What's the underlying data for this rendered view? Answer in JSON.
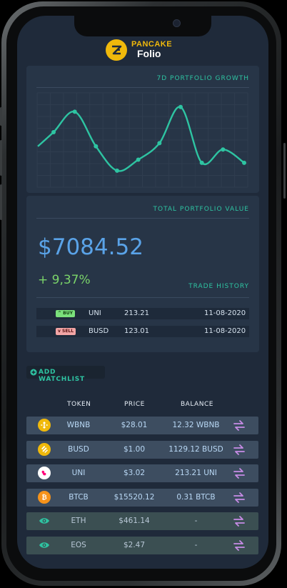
{
  "app": {
    "brand_top": "PANCAKE",
    "brand_bottom": "Folio"
  },
  "growth": {
    "title": "7D PORTFOLIO GROWTH"
  },
  "chart_data": {
    "type": "line",
    "title": "7D PORTFOLIO GROWTH",
    "x": [
      1,
      2,
      3,
      4,
      5,
      6,
      7,
      8,
      9,
      10
    ],
    "values": [
      70,
      96,
      52,
      21,
      35,
      56,
      102,
      31,
      48,
      31
    ],
    "ylim": [
      0,
      120
    ],
    "grid": true,
    "color": "#2ec4a2"
  },
  "portfolio": {
    "title": "TOTAL PORTFOLIO VALUE",
    "value": "$7084.52",
    "change": "+ 9,37%",
    "trade_history_title": "TRADE HISTORY",
    "trades": [
      {
        "type": "BUY",
        "token": "UNI",
        "amount": "213.21",
        "date": "11-08-2020"
      },
      {
        "type": "SELL",
        "token": "BUSD",
        "amount": "123.01",
        "date": "11-08-2020"
      }
    ]
  },
  "watchlist": {
    "add_label": "ADD WATCHLIST",
    "headers": {
      "token": "TOKEN",
      "price": "PRICE",
      "balance": "BALANCE"
    },
    "rows": [
      {
        "token": "WBNB",
        "price": "$28.01",
        "balance": "12.32 WBNB",
        "icon": "bnb-icon",
        "bg": "#3d4d60"
      },
      {
        "token": "BUSD",
        "price": "$1.00",
        "balance": "1129.12 BUSD",
        "icon": "busd-icon",
        "bg": "#3d4d60"
      },
      {
        "token": "UNI",
        "price": "$3.02",
        "balance": "213.21 UNI",
        "icon": "uni-icon",
        "bg": "#3d4d60"
      },
      {
        "token": "BTCB",
        "price": "$15520.12",
        "balance": "0.31 BTCB",
        "icon": "btc-icon",
        "bg": "#3d4d60"
      },
      {
        "token": "ETH",
        "price": "$461.14",
        "balance": "-",
        "icon": "eye-icon",
        "bg": "#3b4f52"
      },
      {
        "token": "EOS",
        "price": "$2.47",
        "balance": "-",
        "icon": "eye-icon",
        "bg": "#3b4f52"
      }
    ]
  },
  "colors": {
    "accent": "#2ec4a2",
    "value": "#5aa3e8",
    "positive": "#7bd46a",
    "brand": "#f0b90b",
    "swap": "#c88ce6"
  }
}
